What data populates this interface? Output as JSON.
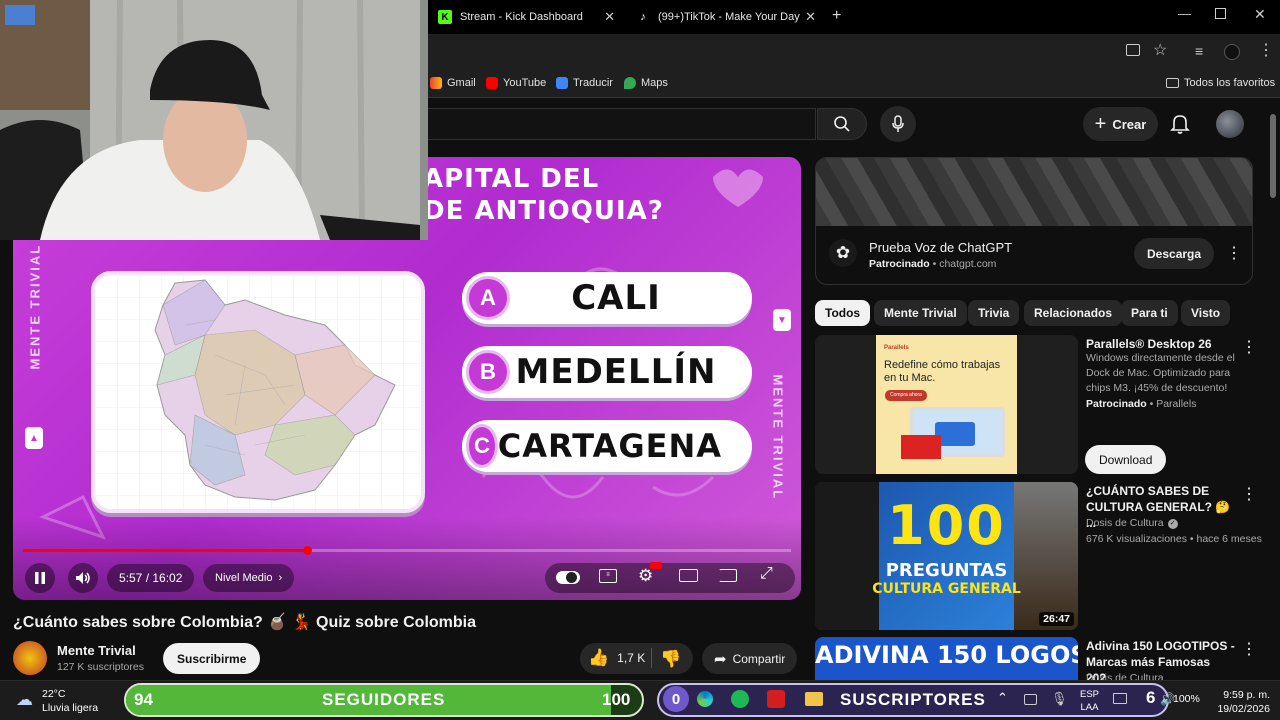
{
  "browser": {
    "tabs": [
      {
        "title": "Stream - Kick Dashboard",
        "icon": "kick-icon"
      },
      {
        "title": "(99+)TikTok - Make Your Day",
        "icon": "tiktok-icon"
      }
    ],
    "bookmarks": [
      "Gmail",
      "YouTube",
      "Traducir",
      "Maps"
    ],
    "all_bookmarks": "Todos los favoritos"
  },
  "header": {
    "create_label": "Crear"
  },
  "video": {
    "question_line1": "APITAL DEL",
    "question_line2": "DE ANTIOQUIA?",
    "answers": [
      {
        "letter": "A",
        "text": "CALI"
      },
      {
        "letter": "B",
        "text": "MEDELLÍN"
      },
      {
        "letter": "C",
        "text": "CARTAGENA"
      }
    ],
    "side_label": "MENTE TRIVIAL",
    "time": "5:57 / 16:02",
    "chapter": "Nivel Medio",
    "progress": 0.37,
    "title": "¿Cuánto sabes sobre Colombia? 🧉 💃 Quiz sobre Colombia",
    "channel": "Mente Trivial",
    "subscribers": "127 K suscriptores",
    "subscribe_label": "Suscribirme",
    "likes": "1,7 K",
    "share_label": "Compartir"
  },
  "sidebar": {
    "ad": {
      "title": "Prueba Voz de ChatGPT",
      "sponsored": "Patrocinado",
      "domain": "chatgpt.com",
      "cta": "Descarga"
    },
    "chips": [
      "Todos",
      "Mente Trivial",
      "Trivia",
      "Relacionados",
      "Para ti",
      "Visto"
    ],
    "parallels_ad": {
      "title": "Parallels® Desktop 26",
      "desc": "Windows directamente desde el Dock de Mac. Optimizado para chips M3. ¡45% de descuento!",
      "sponsored": "Patrocinado",
      "advertiser": "Parallels",
      "thumb_text": "Redefine cómo trabajas en tu Mac.",
      "thumb_brand": "Parallels",
      "thumb_btn": "Compra ahora",
      "cta": "Download"
    },
    "videos": [
      {
        "title": "¿CUÁNTO SABES DE CULTURA GENERAL? 🤔 ...",
        "channel": "Dosis de Cultura",
        "meta": "676 K visualizaciones • hace 6 meses",
        "duration": "26:47",
        "thumb_big": "100",
        "thumb_line1": "PREGUNTAS",
        "thumb_line2": "CULTURA GENERAL"
      },
      {
        "title": "Adivina 150 LOGOTIPOS - Marcas más Famosas 202...",
        "channel": "Dosis de Cultura",
        "thumb_text": "ADIVINA 150 LOGOS"
      }
    ]
  },
  "taskbar": {
    "temp": "22°C",
    "weather": "Lluvia ligera",
    "followers_count": "94",
    "followers_label": "SEGUIDORES",
    "followers_goal": "100",
    "subs_count": "0",
    "subs_label": "SUSCRIPTORES",
    "subs_goal": "6",
    "lang1": "ESP",
    "lang2": "LAA",
    "battery": "100%",
    "time": "9:59 p. m.",
    "date": "19/02/2026"
  },
  "colors": {
    "accent_red": "#ff0000",
    "player_purple": "#c940d9",
    "followers_green": "#53b83a",
    "subs_purple": "#6f58c9"
  }
}
